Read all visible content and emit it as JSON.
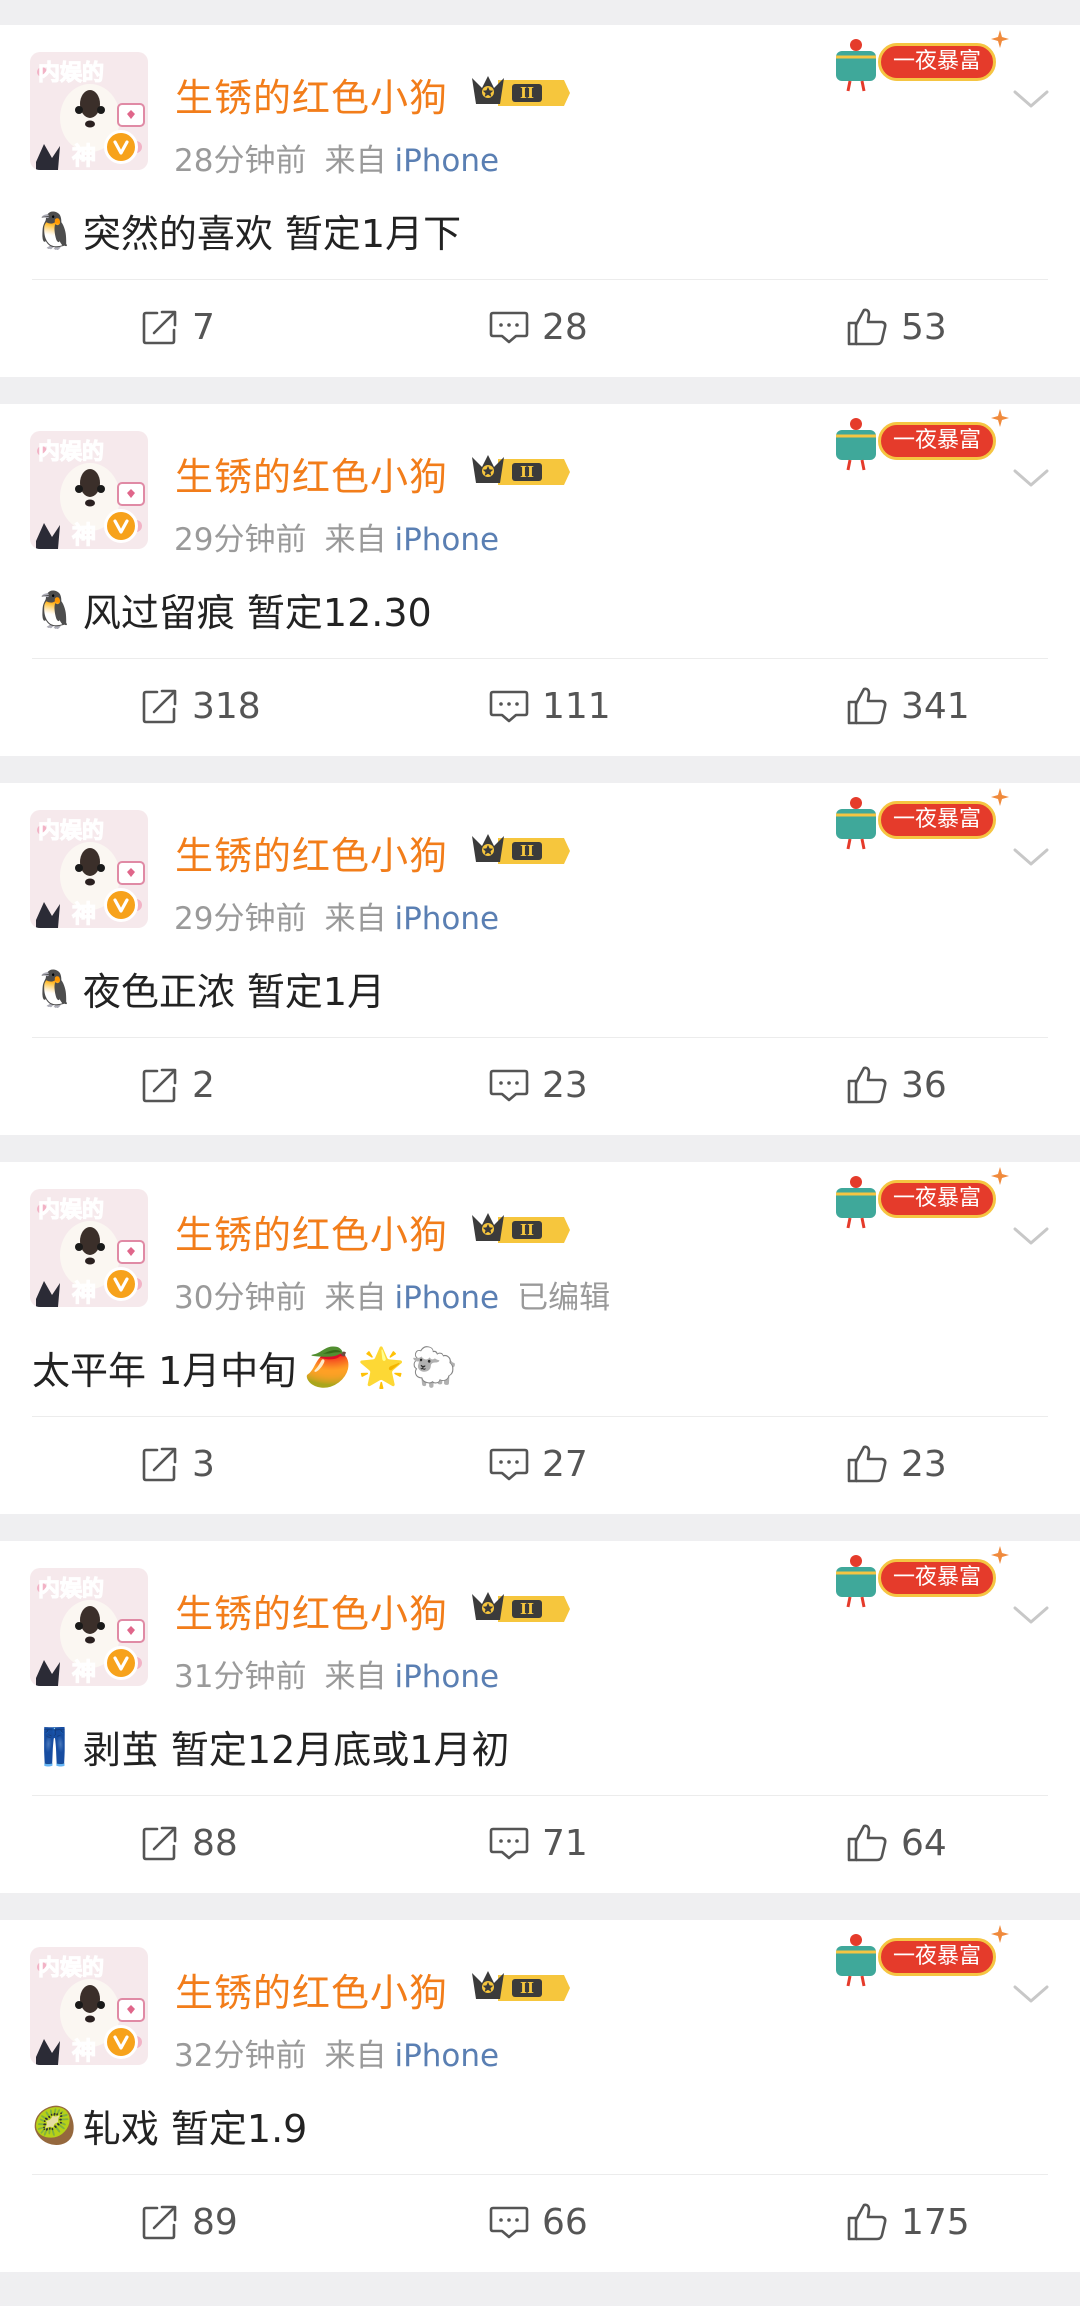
{
  "colors": {
    "background": "#efeff1",
    "username": "#f27d1a",
    "meta": "#9a9a9a",
    "device_link": "#5a7fb3",
    "text": "#222222",
    "badge_red": "#e53b2b",
    "badge_gold": "#f5c542",
    "verified": "#f7a21b"
  },
  "badge_text": "一夜暴富",
  "vip_text": "II",
  "avatar_text": [
    "内娱的",
    "神"
  ],
  "posts": [
    {
      "username": "生锈的红色小狗",
      "time": "28分钟前",
      "source_prefix": "来自",
      "device": "iPhone",
      "edited": "",
      "emoji_icon": "penguin-icon",
      "text": "突然的喜欢 暂定1月下",
      "trailing_icons": [],
      "reposts": "7",
      "comments": "28",
      "likes": "53"
    },
    {
      "username": "生锈的红色小狗",
      "time": "29分钟前",
      "source_prefix": "来自",
      "device": "iPhone",
      "edited": "",
      "emoji_icon": "penguin-icon",
      "text": " 风过留痕 暂定12.30",
      "trailing_icons": [],
      "reposts": "318",
      "comments": "111",
      "likes": "341"
    },
    {
      "username": "生锈的红色小狗",
      "time": "29分钟前",
      "source_prefix": "来自",
      "device": "iPhone",
      "edited": "",
      "emoji_icon": "penguin-icon",
      "text": "夜色正浓 暂定1月",
      "trailing_icons": [],
      "reposts": "2",
      "comments": "23",
      "likes": "36"
    },
    {
      "username": "生锈的红色小狗",
      "time": "30分钟前",
      "source_prefix": "来自",
      "device": "iPhone",
      "edited": "已编辑",
      "emoji_icon": "",
      "text": "太平年 1月中旬",
      "trailing_icons": [
        "mango-icon",
        "star-icon",
        "sheep-icon"
      ],
      "reposts": "3",
      "comments": "27",
      "likes": "23"
    },
    {
      "username": "生锈的红色小狗",
      "time": "31分钟前",
      "source_prefix": "来自",
      "device": "iPhone",
      "edited": "",
      "emoji_icon": "jeans-icon",
      "text": "剥茧 暂定12月底或1月初",
      "trailing_icons": [],
      "reposts": "88",
      "comments": "71",
      "likes": "64"
    },
    {
      "username": "生锈的红色小狗",
      "time": "32分钟前",
      "source_prefix": "来自",
      "device": "iPhone",
      "edited": "",
      "emoji_icon": "kiwi-icon",
      "text": "轧戏 暂定1.9",
      "trailing_icons": [],
      "reposts": "89",
      "comments": "66",
      "likes": "175"
    }
  ]
}
